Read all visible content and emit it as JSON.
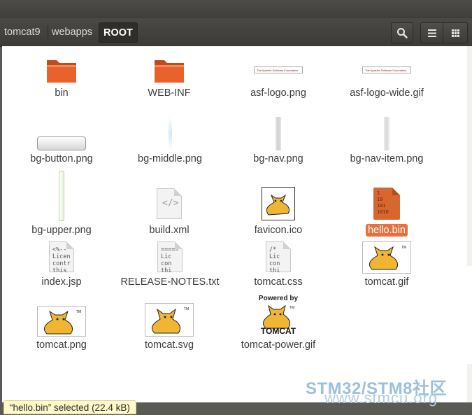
{
  "breadcrumb": [
    "tomcat9",
    "webapps",
    "ROOT"
  ],
  "header": {
    "search_icon": "search-icon",
    "list_view_icon": "list-view-icon",
    "grid_view_icon": "grid-view-icon"
  },
  "files": [
    {
      "name": "bin",
      "icon": "folder-icon"
    },
    {
      "name": "WEB-INF",
      "icon": "folder-icon"
    },
    {
      "name": "asf-logo.png",
      "icon": "image-thumbnail-icon"
    },
    {
      "name": "asf-logo-wide.gif",
      "icon": "image-thumbnail-icon"
    },
    {
      "name": "bg-button.png",
      "icon": "image-thumbnail-icon"
    },
    {
      "name": "bg-middle.png",
      "icon": "image-thumbnail-icon"
    },
    {
      "name": "bg-nav.png",
      "icon": "image-thumbnail-icon"
    },
    {
      "name": "bg-nav-item.png",
      "icon": "image-thumbnail-icon"
    },
    {
      "name": "bg-upper.png",
      "icon": "image-thumbnail-icon"
    },
    {
      "name": "build.xml",
      "icon": "xml-file-icon"
    },
    {
      "name": "favicon.ico",
      "icon": "tomcat-thumbnail-icon"
    },
    {
      "name": "hello.bin",
      "icon": "binary-file-icon",
      "selected": true,
      "thumb_text": "1\n10\n101\n1010"
    },
    {
      "name": "index.jsp",
      "icon": "text-file-icon",
      "thumb_text": "<%--\nLicen\ncontr\nthis"
    },
    {
      "name": "RELEASE-NOTES.txt",
      "icon": "text-file-icon",
      "thumb_text": "=====\nLic\ncon\nthi"
    },
    {
      "name": "tomcat.css",
      "icon": "text-file-icon",
      "thumb_text": "/*\nLic\ncon\nthi"
    },
    {
      "name": "tomcat.gif",
      "icon": "tomcat-thumbnail-icon"
    },
    {
      "name": "tomcat.png",
      "icon": "tomcat-thumbnail-icon"
    },
    {
      "name": "tomcat.svg",
      "icon": "tomcat-thumbnail-icon"
    },
    {
      "name": "tomcat-power.gif",
      "icon": "tomcat-power-thumbnail-icon",
      "thumb_top": "Powered by",
      "thumb_bottom": "TOMCAT"
    }
  ],
  "thumb_captions": {
    "asf": "The Apache Software Foundation",
    "tm": "TM"
  },
  "status": "“hello.bin” selected  (22.4 kB)",
  "watermark": {
    "line1": "STM32/STM8社区",
    "line2": "www.stmcu.org"
  },
  "colors": {
    "selection": "#e9703d",
    "folder": "#e8632b",
    "header": "#3c3b37"
  }
}
